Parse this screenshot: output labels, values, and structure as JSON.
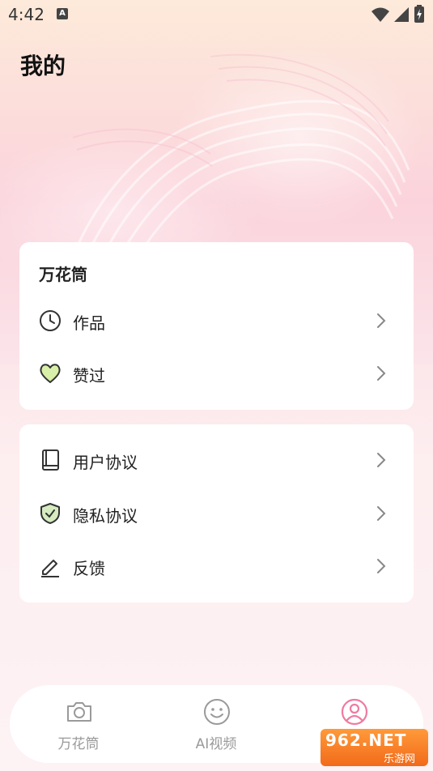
{
  "status_bar": {
    "time": "4:42",
    "notification_icon": "text-notification-icon",
    "wifi_icon": "wifi-icon",
    "signal_icon": "signal-icon",
    "battery_icon": "battery-charging-icon"
  },
  "page": {
    "title": "我的"
  },
  "section_wanhuatong": {
    "title": "万花筒",
    "items": [
      {
        "label": "作品",
        "icon": "clock-icon"
      },
      {
        "label": "赞过",
        "icon": "heart-icon"
      }
    ]
  },
  "section_settings": {
    "items": [
      {
        "label": "用户协议",
        "icon": "book-icon"
      },
      {
        "label": "隐私协议",
        "icon": "shield-check-icon"
      },
      {
        "label": "反馈",
        "icon": "pencil-icon"
      }
    ]
  },
  "tab_bar": {
    "tabs": [
      {
        "label": "万花筒",
        "icon": "camera-icon",
        "active": false
      },
      {
        "label": "AI视频",
        "icon": "smile-icon",
        "active": false
      },
      {
        "label": "",
        "icon": "profile-icon",
        "active": true
      }
    ]
  },
  "watermark": {
    "brand": "962.NET",
    "subtitle": "乐游网"
  },
  "colors": {
    "active_tab": "#f07aa0",
    "inactive_tab": "#9a9a9a",
    "heart_fill": "#d8f0a8",
    "shield_fill": "#d6ecc0"
  }
}
